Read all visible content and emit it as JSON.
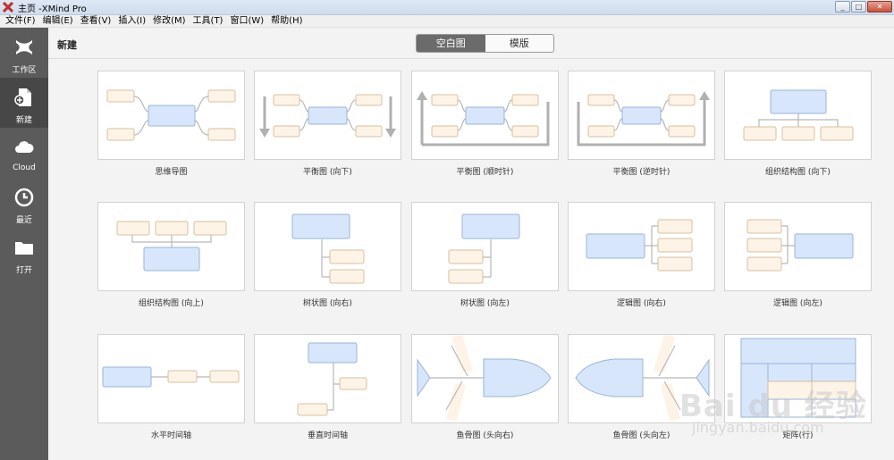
{
  "window": {
    "title": "主页 -XMind Pro",
    "icon": "xmind-logo-icon",
    "controls": [
      "minimize-icon",
      "maximize-icon",
      "close-icon"
    ]
  },
  "menu": {
    "items": [
      {
        "label": "文件(F)"
      },
      {
        "label": "编辑(E)"
      },
      {
        "label": "查看(V)"
      },
      {
        "label": "插入(I)"
      },
      {
        "label": "修改(M)"
      },
      {
        "label": "工具(T)"
      },
      {
        "label": "窗口(W)"
      },
      {
        "label": "帮助(H)"
      }
    ]
  },
  "sidebar": {
    "items": [
      {
        "label": "工作区",
        "icon": "workspace-x-icon",
        "active": false
      },
      {
        "label": "新建",
        "icon": "new-document-icon",
        "active": true
      },
      {
        "label": "Cloud",
        "icon": "cloud-icon",
        "active": false
      },
      {
        "label": "最近",
        "icon": "clock-icon",
        "active": false
      },
      {
        "label": "打开",
        "icon": "folder-icon",
        "active": false
      }
    ]
  },
  "header": {
    "title": "新建",
    "tabs": [
      {
        "label": "空白图",
        "active": true
      },
      {
        "label": "模版",
        "active": false
      }
    ]
  },
  "templates": [
    {
      "label": "思维导图",
      "diagram": "mindmap"
    },
    {
      "label": "平衡图 (向下)",
      "diagram": "balance-down"
    },
    {
      "label": "平衡图 (顺时针)",
      "diagram": "balance-clockwise"
    },
    {
      "label": "平衡图 (逆时针)",
      "diagram": "balance-counterclockwise"
    },
    {
      "label": "组织结构图 (向下)",
      "diagram": "org-down"
    },
    {
      "label": "组织结构图 (向上)",
      "diagram": "org-up"
    },
    {
      "label": "树状图 (向右)",
      "diagram": "tree-right"
    },
    {
      "label": "树状图 (向左)",
      "diagram": "tree-left"
    },
    {
      "label": "逻辑图 (向右)",
      "diagram": "logic-right"
    },
    {
      "label": "逻辑图 (向左)",
      "diagram": "logic-left"
    },
    {
      "label": "水平时间轴",
      "diagram": "timeline-horizontal"
    },
    {
      "label": "垂直时间轴",
      "diagram": "timeline-vertical"
    },
    {
      "label": "鱼骨图 (头向右)",
      "diagram": "fishbone-right"
    },
    {
      "label": "鱼骨图 (头向左)",
      "diagram": "fishbone-left"
    },
    {
      "label": "矩阵(行)",
      "diagram": "matrix-row"
    }
  ],
  "watermark": {
    "logo": "Bai du 经验",
    "url": "jingyan.baidu.com"
  },
  "colors": {
    "central_fill": "#d7e6fb",
    "central_stroke": "#98b4d8",
    "sub_fill": "#fdf3e6",
    "sub_stroke": "#d6c0a0",
    "line": "#b8b8b8",
    "sidebar_bg": "#5b5b5b",
    "sidebar_active": "#474747"
  }
}
